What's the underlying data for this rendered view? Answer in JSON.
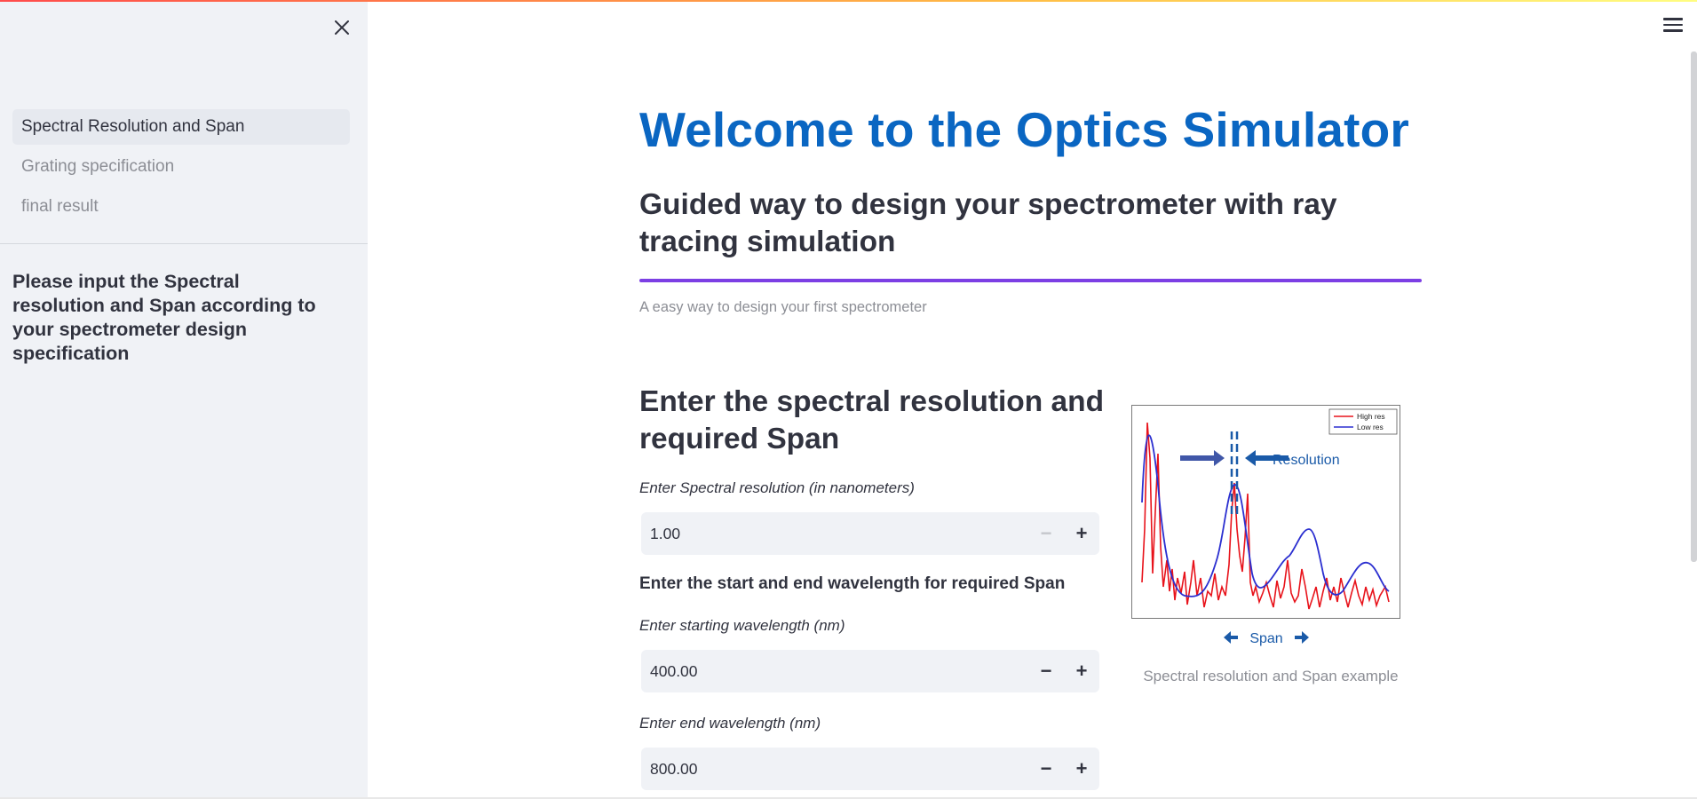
{
  "sidebar": {
    "nav": [
      {
        "label": "Spectral Resolution and Span",
        "active": true
      },
      {
        "label": "Grating specification",
        "active": false
      },
      {
        "label": "final result",
        "active": false
      }
    ],
    "message": "Please input the Spectral resolution and Span according to your spectrometer design specification"
  },
  "main": {
    "title": "Welcome to the Optics Simulator",
    "subtitle": "Guided way to design your spectrometer with ray tracing simulation",
    "caption": "A easy way to design your first spectrometer",
    "section_heading": "Enter the spectral resolution and required Span",
    "resolution": {
      "label": "Enter Spectral resolution (in nanometers)",
      "value": "1.00"
    },
    "span_heading": "Enter the start and end wavelength for required Span",
    "start": {
      "label": "Enter starting wavelength (nm)",
      "value": "400.00"
    },
    "end": {
      "label": "Enter end wavelength (nm)",
      "value": "800.00"
    },
    "figure": {
      "caption": "Spectral resolution and Span example",
      "legend": [
        "High res",
        "Low res"
      ],
      "resolution_label": "Resolution",
      "span_label": "Span",
      "colors": {
        "high": "#e8131b",
        "low": "#2b2fd0",
        "annotation": "#1a5aa8"
      }
    },
    "stepper": {
      "minus": "−",
      "plus": "+"
    }
  },
  "colors": {
    "title": "#0a66c2",
    "divider": "#7c3fe4",
    "sidebar_bg": "#f0f2f6"
  }
}
